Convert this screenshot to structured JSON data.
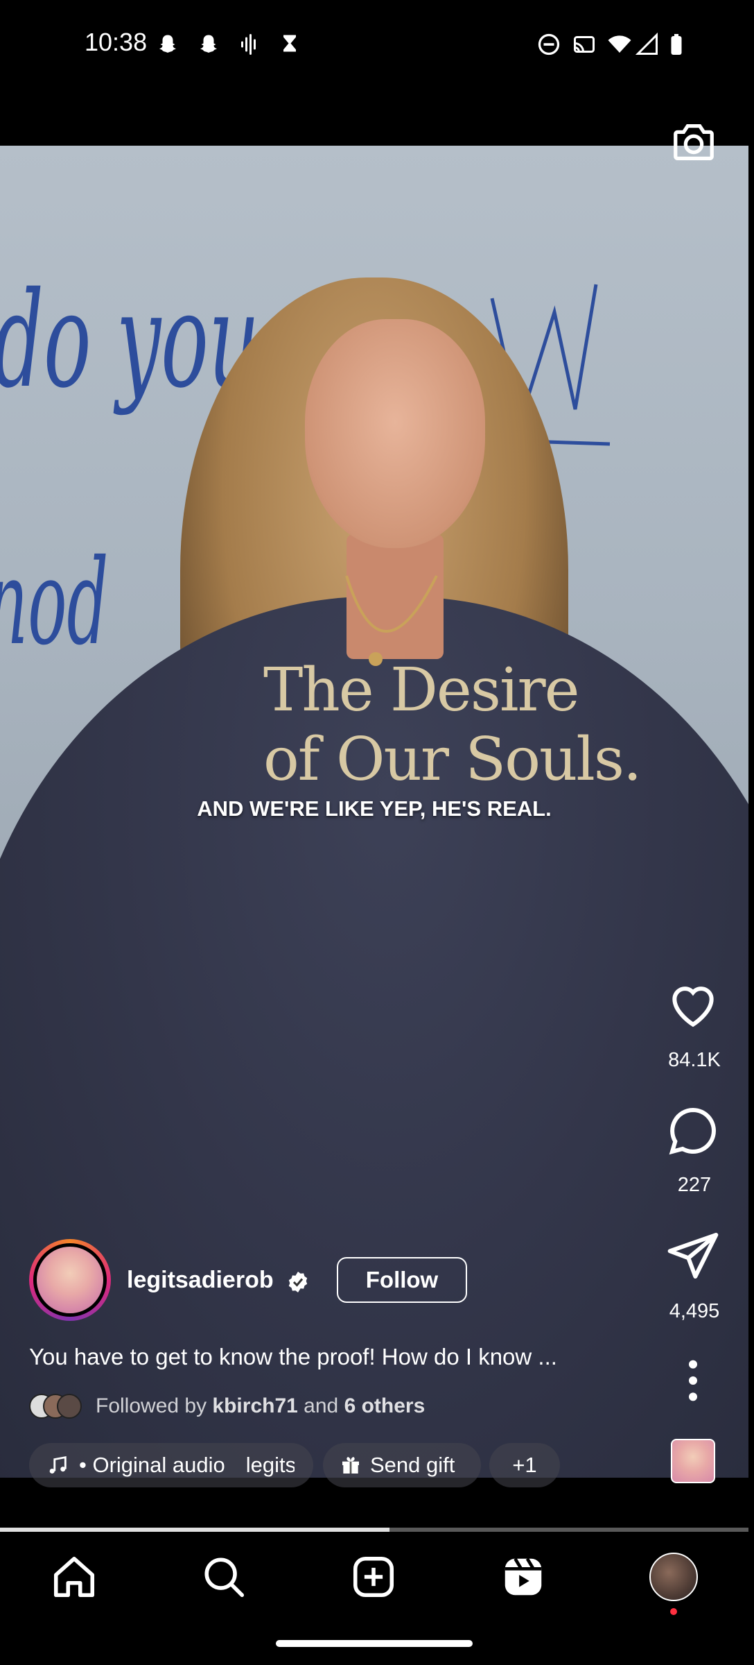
{
  "status_bar": {
    "time": "10:38",
    "left_icons": [
      "snapchat-icon",
      "snapchat-icon",
      "voice-wave-icon",
      "hourglass-icon"
    ],
    "right_icons": [
      "do-not-disturb-icon",
      "cast-icon",
      "wifi-icon",
      "signal-icon",
      "battery-icon"
    ]
  },
  "video": {
    "whiteboard_text_1": "do you",
    "whiteboard_text_2": "nod",
    "subtitle": "AND WE'RE LIKE YEP, HE'S REAL.",
    "shirt_text_1": "The Desire",
    "shirt_text_2": "of Our Souls."
  },
  "actions": {
    "likes": "84.1K",
    "comments": "227",
    "shares": "4,495"
  },
  "author": {
    "username": "legitsadierob",
    "follow_label": "Follow"
  },
  "post": {
    "caption": "You have to get to know the proof! How do I know ...",
    "followed_by_prefix": "Followed by",
    "followed_by_user": "kbirch71",
    "followed_by_and": "and",
    "followed_by_others": "6 others"
  },
  "audio": {
    "label": "• Original audio",
    "artist": "legits"
  },
  "gift": {
    "label": "Send gift"
  },
  "more_chip": {
    "label": "+1"
  },
  "progress": {
    "fraction": 0.52
  },
  "bottom_nav": {
    "items": [
      "home-icon",
      "search-icon",
      "create-icon",
      "reels-icon",
      "profile-avatar"
    ]
  }
}
